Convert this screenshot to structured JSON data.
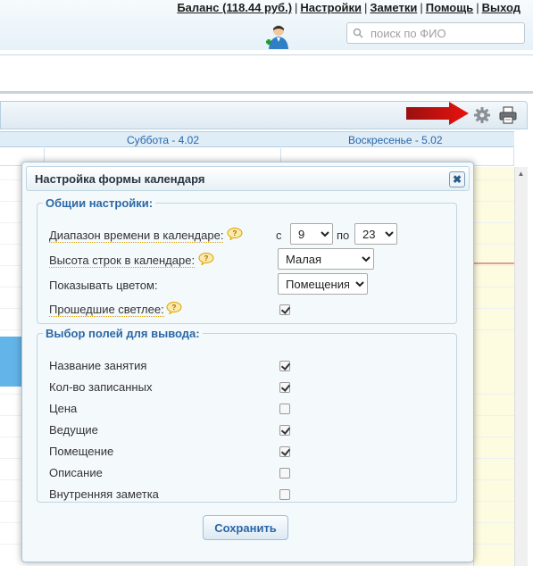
{
  "header": {
    "links": [
      {
        "label": "Баланс (118.44 руб.)"
      },
      {
        "label": "Настройки"
      },
      {
        "label": "Заметки"
      },
      {
        "label": "Помощь"
      },
      {
        "label": "Выход"
      }
    ],
    "search": {
      "placeholder": "поиск по ФИО"
    }
  },
  "calendar": {
    "columns": [
      {
        "label": "Суббота - 4.02"
      },
      {
        "label": "Воскресенье - 5.02"
      }
    ]
  },
  "dialog": {
    "title": "Настройка формы календаря",
    "close_label": "✖",
    "general": {
      "legend": "Общии настройки:",
      "time_range_label": "Диапазон времени в календаре:",
      "from_label": "с",
      "from_value": "9",
      "to_label": "по",
      "to_value": "23",
      "row_height_label": "Высота строк в календаре:",
      "row_height_value": "Малая",
      "color_by_label": "Показывать цветом:",
      "color_by_value": "Помещения",
      "past_lighter_label": "Прошедшие светлее:",
      "past_lighter_checked": true
    },
    "fields": {
      "legend": "Выбор полей для вывода:",
      "items": [
        {
          "label": "Название занятия",
          "checked": true
        },
        {
          "label": "Кол-во записанных",
          "checked": true
        },
        {
          "label": "Цена",
          "checked": false
        },
        {
          "label": "Ведущие",
          "checked": true
        },
        {
          "label": "Помещение",
          "checked": true
        },
        {
          "label": "Описание",
          "checked": false
        },
        {
          "label": "Внутренняя заметка",
          "checked": false
        }
      ]
    },
    "save_label": "Сохранить"
  },
  "colors": {
    "accent": "#2b68a6",
    "event_block": "#63b4e8",
    "weekend": "#fdfbe0",
    "arrow": "#d01010"
  }
}
